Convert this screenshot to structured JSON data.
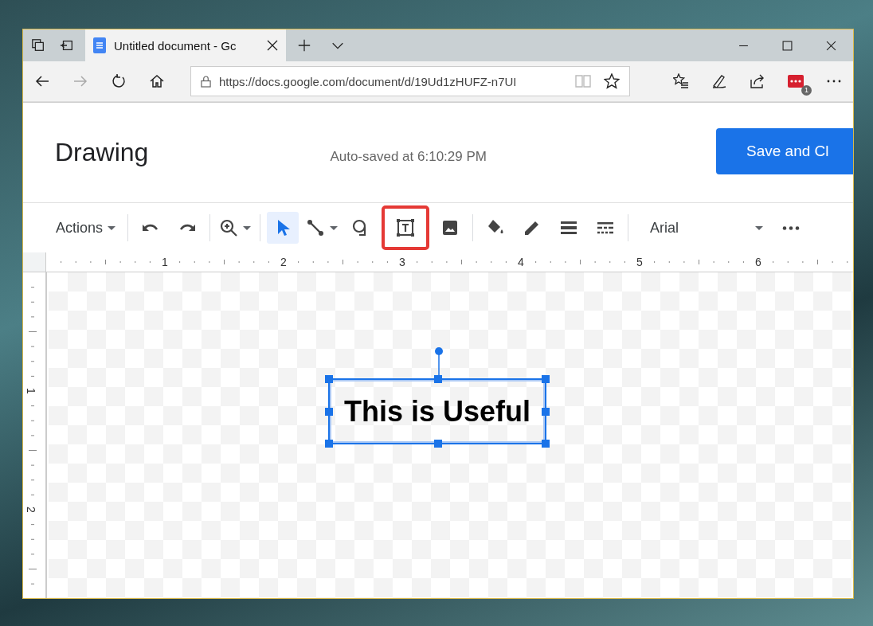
{
  "browser": {
    "tabs": [
      {
        "title": "Untitled document - Gc",
        "selected": true
      }
    ],
    "address": "https://docs.google.com/document/d/19Ud1zHUFZ-n7UI",
    "extension_badge": "1"
  },
  "dialog": {
    "title": "Drawing",
    "status": "Auto-saved at 6:10:29 PM",
    "save_button": "Save and Cl"
  },
  "toolbar": {
    "groups": [
      [
        {
          "kind": "menu",
          "label": "Actions",
          "selected": false,
          "highlighted": false
        }
      ],
      [
        {
          "kind": "undo",
          "selected": false,
          "highlighted": false
        },
        {
          "kind": "redo",
          "selected": false,
          "highlighted": false
        }
      ],
      [
        {
          "kind": "zoom",
          "selected": false,
          "highlighted": false
        }
      ],
      [
        {
          "kind": "select",
          "selected": true,
          "highlighted": false
        },
        {
          "kind": "line",
          "selected": false,
          "highlighted": false
        },
        {
          "kind": "shape",
          "selected": false,
          "highlighted": false
        },
        {
          "kind": "textbox",
          "selected": false,
          "highlighted": true
        },
        {
          "kind": "image",
          "selected": false,
          "highlighted": false
        }
      ],
      [
        {
          "kind": "fill",
          "selected": false,
          "highlighted": false
        },
        {
          "kind": "pen",
          "selected": false,
          "highlighted": false
        },
        {
          "kind": "weight",
          "selected": false,
          "highlighted": false
        },
        {
          "kind": "dash",
          "selected": false,
          "highlighted": false
        }
      ],
      [
        {
          "kind": "font",
          "label": "Arial",
          "selected": false,
          "highlighted": false
        },
        {
          "kind": "more",
          "selected": false,
          "highlighted": false
        }
      ]
    ]
  },
  "rulers": {
    "horizontal": [
      "1",
      "2",
      "3",
      "4",
      "5",
      "6"
    ],
    "vertical": [
      "1",
      "2"
    ]
  },
  "canvas": {
    "text_box": {
      "text": "This is Useful",
      "selected": true
    }
  }
}
